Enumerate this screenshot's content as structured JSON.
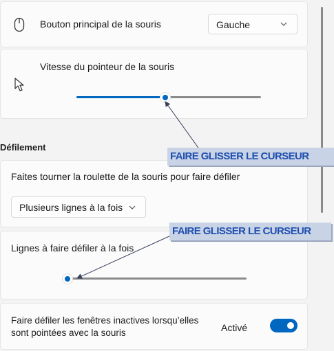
{
  "mouse": {
    "primary_button_label": "Bouton principal de la souris",
    "primary_button_value": "Gauche",
    "pointer_speed_label": "Vitesse du pointeur de la souris",
    "pointer_speed_level": 0.48
  },
  "scrolling": {
    "section_title": "Défilement",
    "wheel_label": "Faites tourner la roulette de la souris pour faire défiler",
    "wheel_value": "Plusieurs lignes à la fois",
    "lines_label": "Lignes à faire défiler à la fois",
    "lines_level": 0.03,
    "inactive_label_line1": "Faire défiler les fenêtres inactives lorsqu’elles",
    "inactive_label_line2": "sont pointées avec la souris",
    "inactive_state": "Activé"
  },
  "annotations": {
    "callout_1": "FAIRE GLISSER LE CURSEUR",
    "callout_2": "FAIRE GLISSER LE CURSEUR"
  },
  "colors": {
    "accent": "#0067c0",
    "callout_bg": "#c9d3e6",
    "callout_text": "#1f4fb0"
  }
}
